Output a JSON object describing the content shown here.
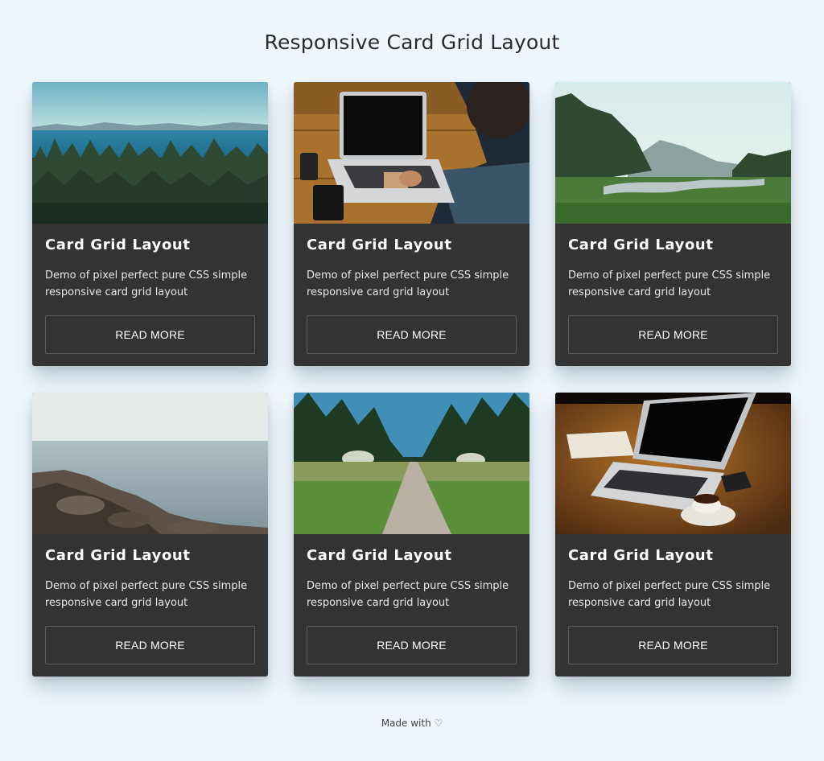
{
  "page": {
    "title": "Responsive Card Grid Layout",
    "footer": "Made with ♡"
  },
  "cards": [
    {
      "image": "coastal-forest-photo",
      "title": "Card Grid Layout",
      "text": "Demo of pixel perfect pure CSS simple responsive card grid layout",
      "button": "READ MORE"
    },
    {
      "image": "laptop-on-desk-photo",
      "title": "Card Grid Layout",
      "text": "Demo of pixel perfect pure CSS simple responsive card grid layout",
      "button": "READ MORE"
    },
    {
      "image": "valley-river-photo",
      "title": "Card Grid Layout",
      "text": "Demo of pixel perfect pure CSS simple responsive card grid layout",
      "button": "READ MORE"
    },
    {
      "image": "rocky-shore-photo",
      "title": "Card Grid Layout",
      "text": "Demo of pixel perfect pure CSS simple responsive card grid layout",
      "button": "READ MORE"
    },
    {
      "image": "forest-path-photo",
      "title": "Card Grid Layout",
      "text": "Demo of pixel perfect pure CSS simple responsive card grid layout",
      "button": "READ MORE"
    },
    {
      "image": "laptop-coffee-photo",
      "title": "Card Grid Layout",
      "text": "Demo of pixel perfect pure CSS simple responsive card grid layout",
      "button": "READ MORE"
    }
  ],
  "colors": {
    "background": "#eef7fc",
    "card": "#333333",
    "button_border": "#5c5c5c",
    "text": "#ffffff"
  }
}
